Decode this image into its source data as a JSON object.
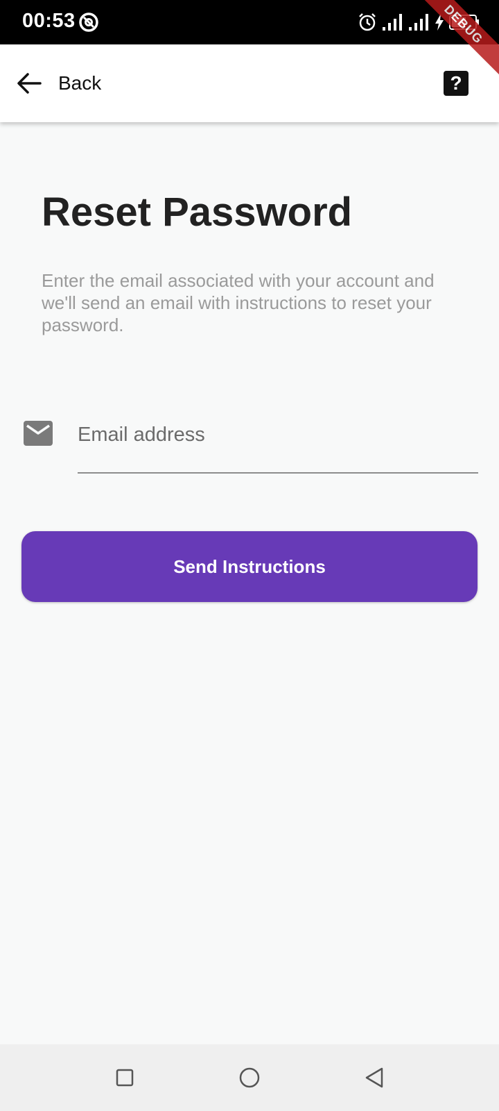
{
  "status_bar": {
    "time": "00:53",
    "icons": [
      "at-sign-icon",
      "alarm-icon",
      "signal-icon",
      "signal-icon",
      "charging-bolt-icon",
      "battery-icon"
    ]
  },
  "debug_banner": "DEBUG",
  "app_bar": {
    "back_label": "Back",
    "back_icon": "arrow-left-icon",
    "help_label": "?",
    "help_icon": "help-icon"
  },
  "main": {
    "title": "Reset Password",
    "description": "Enter the email associated with your account and we'll send an email with instructions to reset your password.",
    "email_field": {
      "icon": "mail-icon",
      "placeholder": "Email address",
      "value": ""
    },
    "send_button_label": "Send Instructions"
  },
  "nav_bar": {
    "buttons": [
      "recents-square-icon",
      "home-circle-icon",
      "back-triangle-icon"
    ]
  },
  "colors": {
    "accent": "#673ab7",
    "background": "#f8f9f9",
    "title": "#222222",
    "description": "#9a9a9a"
  }
}
